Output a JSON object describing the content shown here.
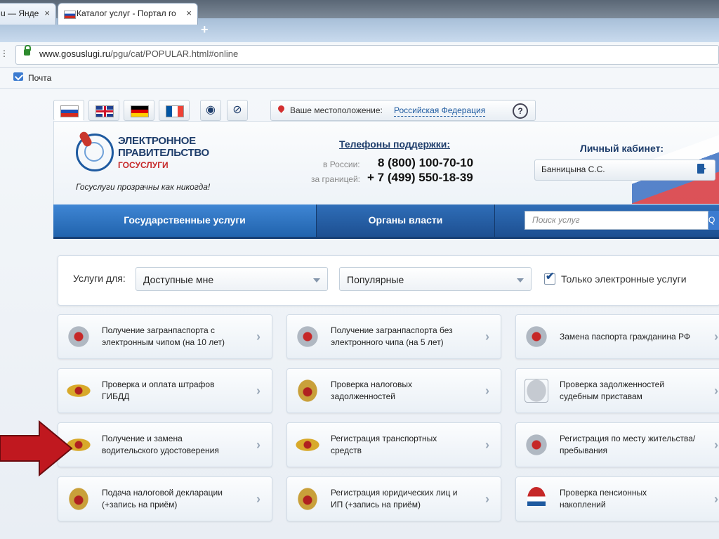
{
  "browser": {
    "tabs": [
      {
        "label": "u — Янде"
      },
      {
        "label": "Каталог услуг - Портал го"
      }
    ],
    "new_tab": "+",
    "url_host": "www.gosuslugi.ru",
    "url_path": "/pgu/cat/POPULAR.html#online",
    "bookmark": "Почта",
    "close_glyph": "×"
  },
  "site": {
    "location_label": "Ваше местоположение:",
    "location_value": "Российская Федерация",
    "help": "?",
    "logo_line1": "ЭЛЕКТРОННОЕ",
    "logo_line2": "ПРАВИТЕЛЬСТВО",
    "logo_line3": "ГОСУСЛУГИ",
    "slogan": "Госуслуги прозрачны как никогда!",
    "support_title": "Телефоны поддержки:",
    "support_ru_label": "в России:",
    "support_ru_number": "8 (800) 100-70-10",
    "support_abroad_label": "за границей:",
    "support_abroad_number": "+ 7 (499) 550-18-39",
    "cabinet_title": "Личный кабинет:",
    "cabinet_user": "Банницына С.С.",
    "nav_services": "Государственные услуги",
    "nav_authorities": "Органы власти",
    "search_placeholder": "Поиск услуг",
    "search_button": "Q"
  },
  "filters": {
    "for_label": "Услуги для:",
    "audience": "Доступные мне",
    "category": "Популярные",
    "only_electronic": "Только электронные услуги",
    "only_electronic_checked": true
  },
  "services": [
    {
      "l1": "Получение загранпаспорта с",
      "l2": "электронным чипом (на 10 лет)",
      "icon": "migration-service-icon"
    },
    {
      "l1": "Получение загранпаспорта без",
      "l2": "электронного чипа (на 5 лет)",
      "icon": "migration-service-icon"
    },
    {
      "l1": "Замена паспорта гражданина РФ",
      "l2": "",
      "icon": "migration-service-icon"
    },
    {
      "l1": "Проверка и оплата штрафов",
      "l2": "ГИБДД",
      "icon": "police-eagle-icon"
    },
    {
      "l1": "Проверка налоговых",
      "l2": "задолженностей",
      "icon": "coat-of-arms-icon"
    },
    {
      "l1": "Проверка задолженностей",
      "l2": "судебным приставам",
      "icon": "bailiff-emblem-icon"
    },
    {
      "l1": "Получение и замена",
      "l2": "водительского удостоверения",
      "icon": "police-eagle-icon"
    },
    {
      "l1": "Регистрация транспортных",
      "l2": "средств",
      "icon": "police-eagle-icon"
    },
    {
      "l1": "Регистрация по месту жительства/",
      "l2": "пребывания",
      "icon": "migration-service-icon"
    },
    {
      "l1": "Подача налоговой декларации",
      "l2": "(+запись на приём)",
      "icon": "coat-of-arms-icon"
    },
    {
      "l1": "Регистрация юридических лиц и",
      "l2": "ИП (+запись на приём)",
      "icon": "coat-of-arms-icon"
    },
    {
      "l1": "Проверка пенсионных",
      "l2": "накоплений",
      "icon": "pension-fund-icon"
    }
  ],
  "colors": {
    "nav_blue": "#1d4f91",
    "annotation_arrow": "#c0181f"
  }
}
